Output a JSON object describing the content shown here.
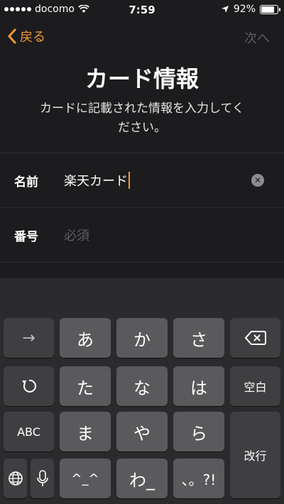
{
  "status_bar": {
    "carrier": "docomo",
    "time": "7:59",
    "battery": "92%",
    "battery_level": 0.92
  },
  "nav": {
    "back_label": "戻る",
    "next_label": "次へ"
  },
  "header": {
    "title": "カード情報",
    "description": "カードに記載された情報を入力してください。"
  },
  "form": {
    "name_label": "名前",
    "name_value": "楽天カード",
    "number_label": "番号",
    "number_placeholder": "必須"
  },
  "keyboard": {
    "row1": [
      "→",
      "あ",
      "か",
      "さ",
      "⌫"
    ],
    "row2": [
      "↺",
      "た",
      "な",
      "は",
      "空白"
    ],
    "row3": [
      "ABC",
      "ま",
      "や",
      "ら",
      "改行"
    ],
    "row4": [
      "🌐",
      "🎤",
      "^_^",
      "わ_",
      "、。?!"
    ]
  }
}
